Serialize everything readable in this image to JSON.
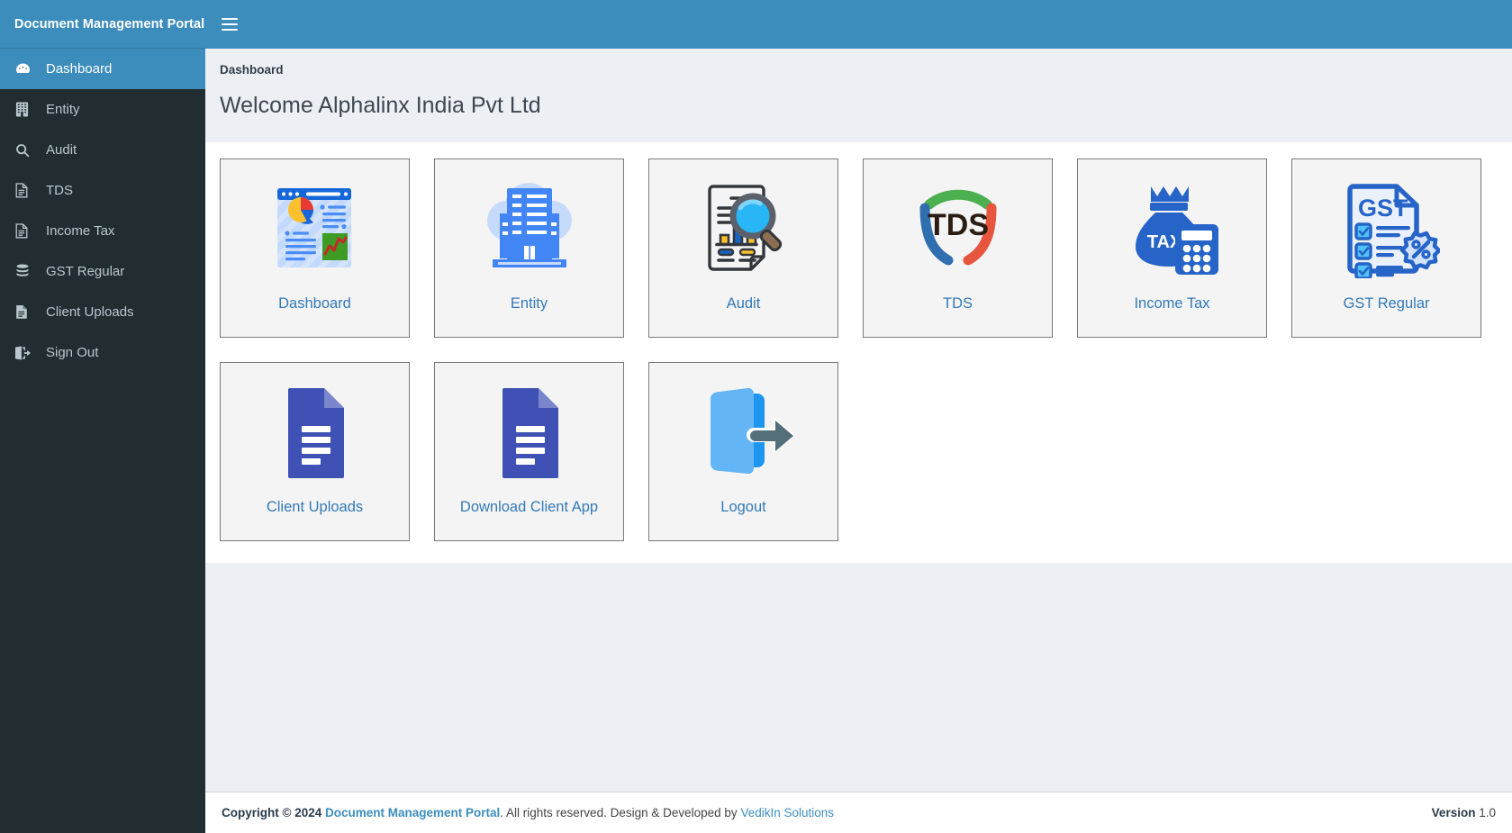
{
  "brand": {
    "title": "Document Management Portal"
  },
  "topbar": {
    "menu_toggle_label": "Toggle navigation"
  },
  "sidebar": {
    "items": [
      {
        "label": "Dashboard",
        "icon": "dashboard-icon",
        "active": true
      },
      {
        "label": "Entity",
        "icon": "building-icon",
        "active": false
      },
      {
        "label": "Audit",
        "icon": "search-icon",
        "active": false
      },
      {
        "label": "TDS",
        "icon": "file-icon",
        "active": false
      },
      {
        "label": "Income Tax",
        "icon": "file-icon",
        "active": false
      },
      {
        "label": "GST Regular",
        "icon": "database-icon",
        "active": false
      },
      {
        "label": "Client Uploads",
        "icon": "file-text-icon",
        "active": false
      },
      {
        "label": "Sign Out",
        "icon": "sign-out-icon",
        "active": false
      }
    ]
  },
  "main": {
    "breadcrumb": "Dashboard",
    "welcome": "Welcome Alphalinx India Pvt Ltd",
    "tiles": [
      {
        "label": "Dashboard",
        "icon": "dashboard-report-icon"
      },
      {
        "label": "Entity",
        "icon": "building-cloud-icon"
      },
      {
        "label": "Audit",
        "icon": "audit-magnifier-icon"
      },
      {
        "label": "TDS",
        "icon": "tds-shield-icon"
      },
      {
        "label": "Income Tax",
        "icon": "tax-bag-calculator-icon"
      },
      {
        "label": "GST Regular",
        "icon": "gst-document-icon"
      },
      {
        "label": "Client Uploads",
        "icon": "document-icon"
      },
      {
        "label": "Download Client App",
        "icon": "document-icon"
      },
      {
        "label": "Logout",
        "icon": "logout-door-icon"
      }
    ]
  },
  "footer": {
    "copyright_prefix": "Copyright © 2024",
    "portal_link": "Document Management Portal",
    "rights_text": ". All rights reserved. Design & Developed by",
    "developer_link": "VedikIn Solutions",
    "version_label": "Version",
    "version_value": "1.0"
  },
  "colors": {
    "brand_blue": "#3c8dbc",
    "sidebar_dark": "#222d32",
    "page_bg": "#ecf0f5",
    "link_blue": "#337ab7",
    "tile_bg": "#f4f4f4"
  }
}
